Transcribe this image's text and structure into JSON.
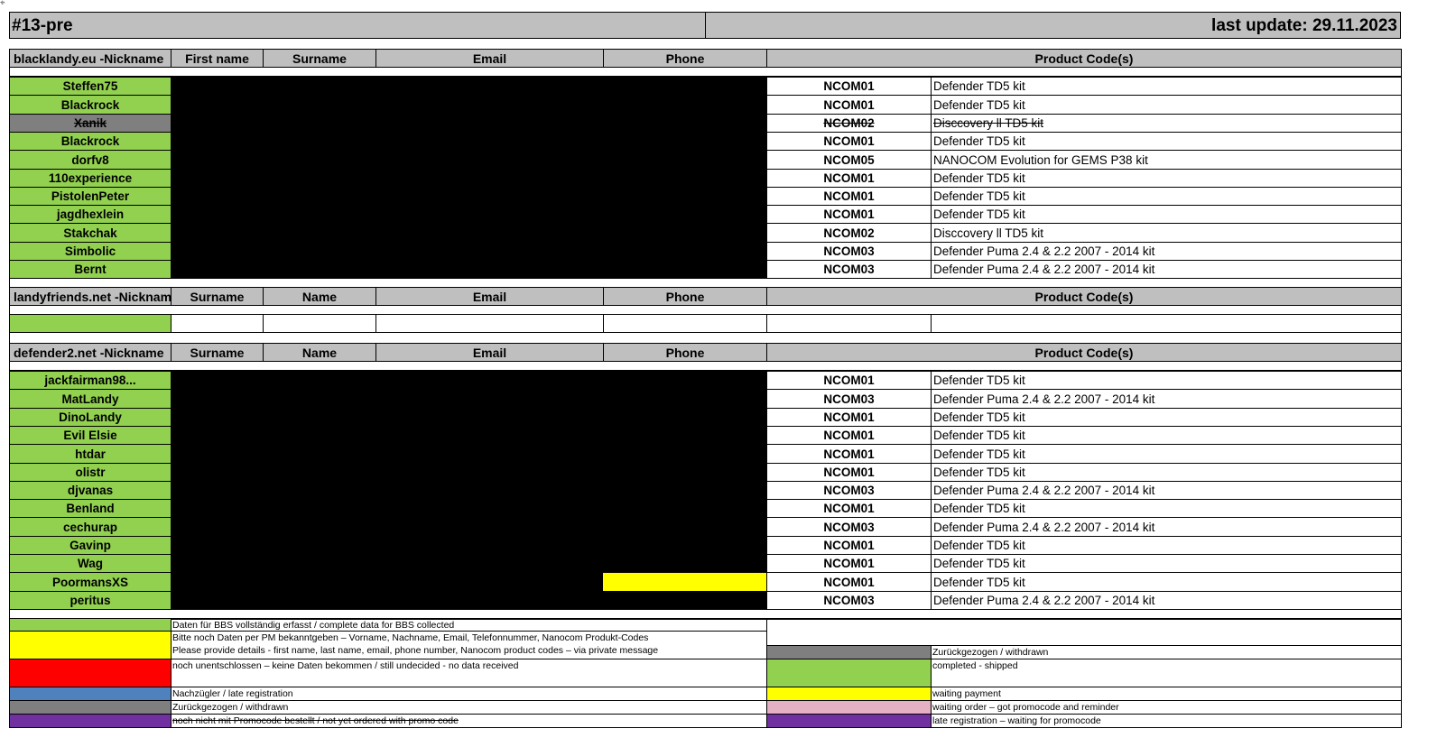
{
  "header": {
    "title": "#13-pre",
    "last_update": "last update: 29.11.2023"
  },
  "columns": {
    "blacklandy": [
      "blacklandy.eu -Nickname",
      "First name",
      "Surname",
      "Email",
      "Phone",
      "Product Code(s)"
    ],
    "landyfriends": [
      "landyfriends.net -Nickname",
      "Surname",
      "Name",
      "Email",
      "Phone",
      "Product Code(s)"
    ],
    "defender2": [
      "defender2.net -Nickname",
      "Surname",
      "Name",
      "Email",
      "Phone",
      "Product Code(s)"
    ]
  },
  "blacklandy_rows": [
    {
      "nick": "Steffen75",
      "code": "NCOM01",
      "product": "Defender TD5 kit",
      "status": "complete"
    },
    {
      "nick": "Blackrock",
      "code": "NCOM01",
      "product": "Defender TD5 kit",
      "status": "complete"
    },
    {
      "nick": "Xanik",
      "code": "NCOM02",
      "product": "Disccovery ll TD5 kit",
      "status": "withdrawn"
    },
    {
      "nick": "Blackrock",
      "code": "NCOM01",
      "product": "Defender TD5 kit",
      "status": "complete"
    },
    {
      "nick": "dorfv8",
      "code": "NCOM05",
      "product": "NANOCOM Evolution for GEMS P38 kit",
      "status": "complete"
    },
    {
      "nick": "110experience",
      "code": "NCOM01",
      "product": "Defender TD5 kit",
      "status": "complete"
    },
    {
      "nick": "PistolenPeter",
      "code": "NCOM01",
      "product": "Defender TD5 kit",
      "status": "complete"
    },
    {
      "nick": "jagdhexlein",
      "code": "NCOM01",
      "product": "Defender TD5 kit",
      "status": "complete"
    },
    {
      "nick": "Stakchak",
      "code": "NCOM02",
      "product": "Disccovery ll TD5 kit",
      "status": "complete"
    },
    {
      "nick": "Simbolic",
      "code": "NCOM03",
      "product": "Defender Puma 2.4 & 2.2 2007 - 2014 kit",
      "status": "complete"
    },
    {
      "nick": "Bernt",
      "code": "NCOM03",
      "product": "Defender Puma 2.4 & 2.2 2007 - 2014 kit",
      "status": "complete"
    }
  ],
  "defender2_rows": [
    {
      "nick": "jackfairman98...",
      "code": "NCOM01",
      "product": "Defender TD5 kit",
      "status": "complete"
    },
    {
      "nick": "MatLandy",
      "code": "NCOM03",
      "product": "Defender Puma 2.4 & 2.2 2007 - 2014 kit",
      "status": "complete"
    },
    {
      "nick": "DinoLandy",
      "code": "NCOM01",
      "product": "Defender TD5 kit",
      "status": "complete"
    },
    {
      "nick": "Evil Elsie",
      "code": "NCOM01",
      "product": "Defender TD5 kit",
      "status": "complete"
    },
    {
      "nick": "htdar",
      "code": "NCOM01",
      "product": "Defender TD5 kit",
      "status": "complete"
    },
    {
      "nick": "olistr",
      "code": "NCOM01",
      "product": "Defender TD5 kit",
      "status": "complete"
    },
    {
      "nick": "djvanas",
      "code": "NCOM03",
      "product": "Defender Puma 2.4 & 2.2 2007 - 2014 kit",
      "status": "complete"
    },
    {
      "nick": "Benland",
      "code": "NCOM01",
      "product": "Defender TD5 kit",
      "status": "complete"
    },
    {
      "nick": "cechurap",
      "code": "NCOM03",
      "product": "Defender Puma 2.4 & 2.2 2007 - 2014 kit",
      "status": "complete"
    },
    {
      "nick": "Gavinp",
      "code": "NCOM01",
      "product": "Defender TD5 kit",
      "status": "complete"
    },
    {
      "nick": "Wag",
      "code": "NCOM01",
      "product": "Defender TD5 kit",
      "status": "complete"
    },
    {
      "nick": "PoormansXS",
      "code": "NCOM01",
      "product": "Defender TD5 kit",
      "status": "complete"
    },
    {
      "nick": "peritus",
      "code": "NCOM03",
      "product": "Defender Puma 2.4 & 2.2 2007 - 2014 kit",
      "status": "complete"
    }
  ],
  "legend_left": [
    {
      "color": "green",
      "text": "Daten für BBS vollständig erfasst / complete data for BBS collected"
    },
    {
      "color": "yellow",
      "text": "Bitte noch Daten per PM bekanntgeben – Vorname, Nachname, Email, Telefonnummer, Nanocom Produkt-Codes",
      "text2": "Please provide details - first name, last name, email, phone number, Nanocom product codes – via private message"
    },
    {
      "color": "red",
      "text": "noch unentschlossen – keine Daten bekommen / still undecided - no data received"
    },
    {
      "color": "blue",
      "text": "Nachzügler / late registration"
    },
    {
      "color": "darkgray",
      "text": "Zurückgezogen / withdrawn"
    },
    {
      "color": "purple",
      "text": "noch nicht mit Promocode bestellt / not yet ordered with promo code"
    }
  ],
  "legend_right": [
    {
      "color": "darkgray",
      "text": "Zurückgezogen / withdrawn"
    },
    {
      "color": "green",
      "text": "completed - shipped"
    },
    {
      "color": "yellow",
      "text": "waiting payment"
    },
    {
      "color": "pink",
      "text": "waiting order – got promocode and reminder"
    },
    {
      "color": "purple",
      "text": "late registration – waiting for promocode"
    }
  ],
  "colors": {
    "green": "#92d050",
    "gray_header": "#bfbfbf",
    "darkgray": "#7f7f7f",
    "yellow": "#ffff00",
    "red": "#ff0000",
    "blue": "#4f81bd",
    "purple": "#7030a0",
    "pink": "#e6b0c4"
  }
}
